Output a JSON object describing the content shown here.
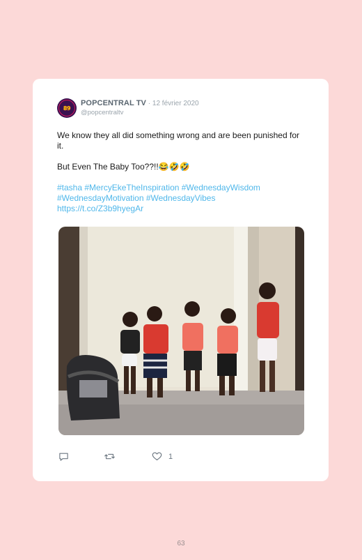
{
  "tweet": {
    "avatar_text": "89",
    "display_name": "POPCENTRAL TV",
    "date": " · 12 février 2020",
    "handle": "@popcentraltv",
    "line1": "We know they all did something wrong and are been punished for it.",
    "line2": "But Even The Baby Too??!!😂🤣🤣",
    "hashtags": "#tasha #MercyEkeTheInspiration #WednesdayWisdom #WednesdayMotivation #WednesdayVibes",
    "link": "https://t.co/Z3b9hyegAr",
    "like_count": "1"
  },
  "icons": {
    "reply": "comment-bubble-icon",
    "retweet": "retweet-arrows-icon",
    "like": "heart-icon"
  },
  "colors": {
    "page_background": "#fcd9d8",
    "card_background": "#ffffff",
    "link": "#4fb7ea",
    "avatar": "#3a1150"
  },
  "page": {
    "number": "63"
  }
}
